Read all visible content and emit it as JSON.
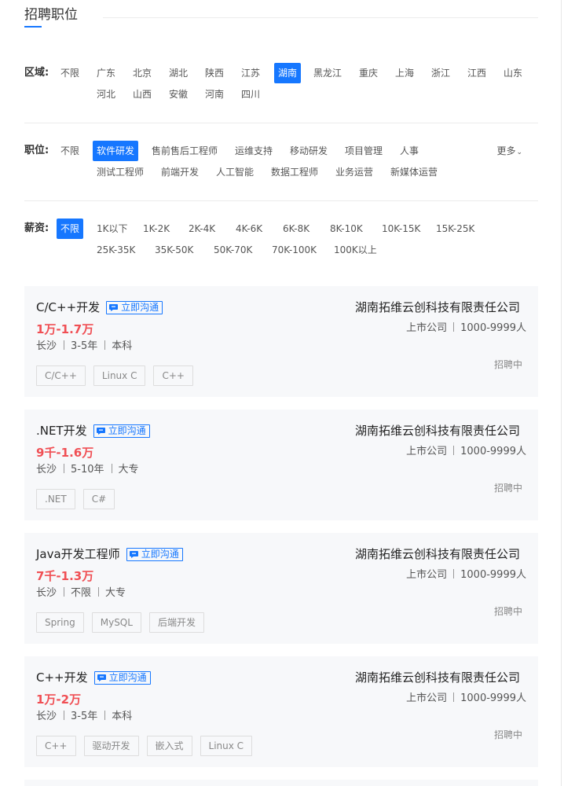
{
  "section_title": "招聘职位",
  "filters": {
    "region": {
      "label": "区域:",
      "options": [
        "不限",
        "广东",
        "北京",
        "湖北",
        "陕西",
        "江苏",
        "湖南",
        "黑龙江",
        "重庆",
        "上海",
        "浙江",
        "江西",
        "山东",
        "河北",
        "山西",
        "安徽",
        "河南",
        "四川"
      ],
      "selected": "湖南"
    },
    "position": {
      "label": "职位:",
      "options": [
        "不限",
        "软件研发",
        "售前售后工程师",
        "运维支持",
        "移动研发",
        "项目管理",
        "人事",
        "测试工程师",
        "前端开发",
        "人工智能",
        "数据工程师",
        "业务运营",
        "新媒体运营"
      ],
      "selected": "软件研发",
      "more_label": "更多"
    },
    "salary": {
      "label": "薪资:",
      "options": [
        "不限",
        "1K以下",
        "1K-2K",
        "2K-4K",
        "4K-6K",
        "6K-8K",
        "8K-10K",
        "10K-15K",
        "15K-25K",
        "25K-35K",
        "35K-50K",
        "50K-70K",
        "70K-100K",
        "100K以上"
      ],
      "selected": "不限"
    }
  },
  "chat_label": "立即沟通",
  "jobs": [
    {
      "title": "C/C++开发",
      "salary": "1万-1.7万",
      "city": "长沙",
      "experience": "3-5年",
      "education": "本科",
      "tags": [
        "C/C++",
        "Linux C",
        "C++"
      ],
      "company": "湖南拓维云创科技有限责任公司",
      "company_type": "上市公司",
      "company_size": "1000-9999人",
      "status": "招聘中"
    },
    {
      "title": ".NET开发",
      "salary": "9千-1.6万",
      "city": "长沙",
      "experience": "5-10年",
      "education": "大专",
      "tags": [
        ".NET",
        "C#"
      ],
      "company": "湖南拓维云创科技有限责任公司",
      "company_type": "上市公司",
      "company_size": "1000-9999人",
      "status": "招聘中"
    },
    {
      "title": "Java开发工程师",
      "salary": "7千-1.3万",
      "city": "长沙",
      "experience": "不限",
      "education": "大专",
      "tags": [
        "Spring",
        "MySQL",
        "后端开发"
      ],
      "company": "湖南拓维云创科技有限责任公司",
      "company_type": "上市公司",
      "company_size": "1000-9999人",
      "status": "招聘中"
    },
    {
      "title": "C++开发",
      "salary": "1万-2万",
      "city": "长沙",
      "experience": "3-5年",
      "education": "本科",
      "tags": [
        "C++",
        "驱动开发",
        "嵌入式",
        "Linux C"
      ],
      "company": "湖南拓维云创科技有限责任公司",
      "company_type": "上市公司",
      "company_size": "1000-9999人",
      "status": "招聘中"
    }
  ],
  "colors": {
    "accent": "#1677ff",
    "salary": "#f04f54",
    "card_bg": "#f7f8fa"
  }
}
